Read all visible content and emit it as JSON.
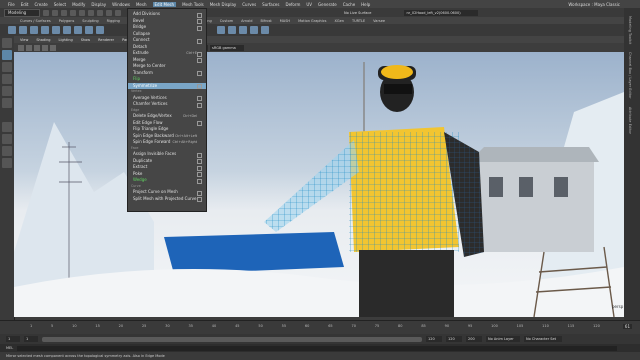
{
  "menubar": {
    "items": [
      "File",
      "Edit",
      "Create",
      "Select",
      "Modify",
      "Display",
      "Windows",
      "Mesh",
      "Edit Mesh",
      "Mesh Tools",
      "Mesh Display",
      "Curves",
      "Surfaces",
      "Deform",
      "UV",
      "Generate",
      "Cache",
      "Help"
    ],
    "active": "Edit Mesh",
    "workspace": "Workspace : Maya Classic"
  },
  "statusline": {
    "mode": "Modeling",
    "live_surface": "No Live Surface",
    "field_value": "nr_02Hood_left_v2(0600.0600)"
  },
  "shelf_tabs": [
    "Curves / Surfaces",
    "Polygons",
    "Sculpting",
    "Rigging",
    "Animation",
    "Rendering",
    "FX",
    "FX Caching",
    "Custom",
    "Arnold",
    "Bifrost",
    "MASH",
    "Motion Graphics",
    "XGen",
    "TURTLE",
    "Varsee"
  ],
  "panel_menu": [
    "View",
    "Shading",
    "Lighting",
    "Show",
    "Renderer",
    "Panels"
  ],
  "panel_toolbar": {
    "gamma": "sRGB gamma",
    "exposure": "0.00",
    "gamma_value": "1.00"
  },
  "edit_mesh_menu": {
    "sections": [
      {
        "header": "",
        "items": [
          {
            "label": "Add Divisions",
            "option": true
          },
          {
            "label": "Bevel",
            "option": true
          },
          {
            "label": "Bridge",
            "option": true
          },
          {
            "label": "Collapse",
            "option": false
          },
          {
            "label": "Connect",
            "option": true
          },
          {
            "label": "Detach",
            "option": false
          },
          {
            "label": "Extrude",
            "shortcut": "Ctrl+E",
            "option": true
          },
          {
            "label": "Merge",
            "option": true
          },
          {
            "label": "Merge to Center",
            "option": false
          },
          {
            "label": "Transform",
            "option": true
          },
          {
            "label": "Flip",
            "option": false,
            "state": "green"
          },
          {
            "label": "Symmetrize",
            "option": true,
            "state": "highlight"
          }
        ]
      },
      {
        "header": "Vertex",
        "items": [
          {
            "label": "Average Vertices",
            "option": true
          },
          {
            "label": "Chamfer Vertices",
            "option": true
          }
        ]
      },
      {
        "header": "Edge",
        "items": [
          {
            "label": "Delete Edge/Vertex",
            "shortcut": "Ctrl+Del",
            "option": false
          },
          {
            "label": "Edit Edge Flow",
            "option": true
          },
          {
            "label": "Flip Triangle Edge",
            "option": false
          },
          {
            "label": "Spin Edge Backward",
            "shortcut": "Ctrl+Alt+Left",
            "option": false
          },
          {
            "label": "Spin Edge Forward",
            "shortcut": "Ctrl+Alt+Right",
            "option": false
          }
        ]
      },
      {
        "header": "Face",
        "items": [
          {
            "label": "Assign Invisible Faces",
            "option": true
          },
          {
            "label": "Duplicate",
            "option": true
          },
          {
            "label": "Extract",
            "option": true
          },
          {
            "label": "Poke",
            "option": true
          },
          {
            "label": "Wedge",
            "option": true,
            "state": "green"
          }
        ]
      },
      {
        "header": "Curve",
        "items": [
          {
            "label": "Project Curve on Mesh",
            "option": true
          },
          {
            "label": "Split Mesh with Projected Curve",
            "option": true
          }
        ]
      }
    ]
  },
  "timeslider": {
    "ticks": [
      "1",
      "5",
      "10",
      "15",
      "20",
      "25",
      "30",
      "35",
      "40",
      "45",
      "50",
      "55",
      "60",
      "65",
      "70",
      "75",
      "80",
      "85",
      "90",
      "95",
      "100",
      "105",
      "110",
      "115",
      "120"
    ],
    "current": "61"
  },
  "range": {
    "start": "1",
    "inner_start": "1",
    "inner_end": "120",
    "end": "120",
    "extra_end": "200",
    "anim_layer": "No Anim Layer",
    "character_set": "No Character Set"
  },
  "command_line": {
    "label": "MEL"
  },
  "help_line": {
    "text": "Mirror selected mesh component across the topological symmetry axis. Also in Edge Mode"
  },
  "right_tabs": [
    "Modeling Toolkit",
    "Channel Box / Layer Editor",
    "Attribute Editor"
  ]
}
